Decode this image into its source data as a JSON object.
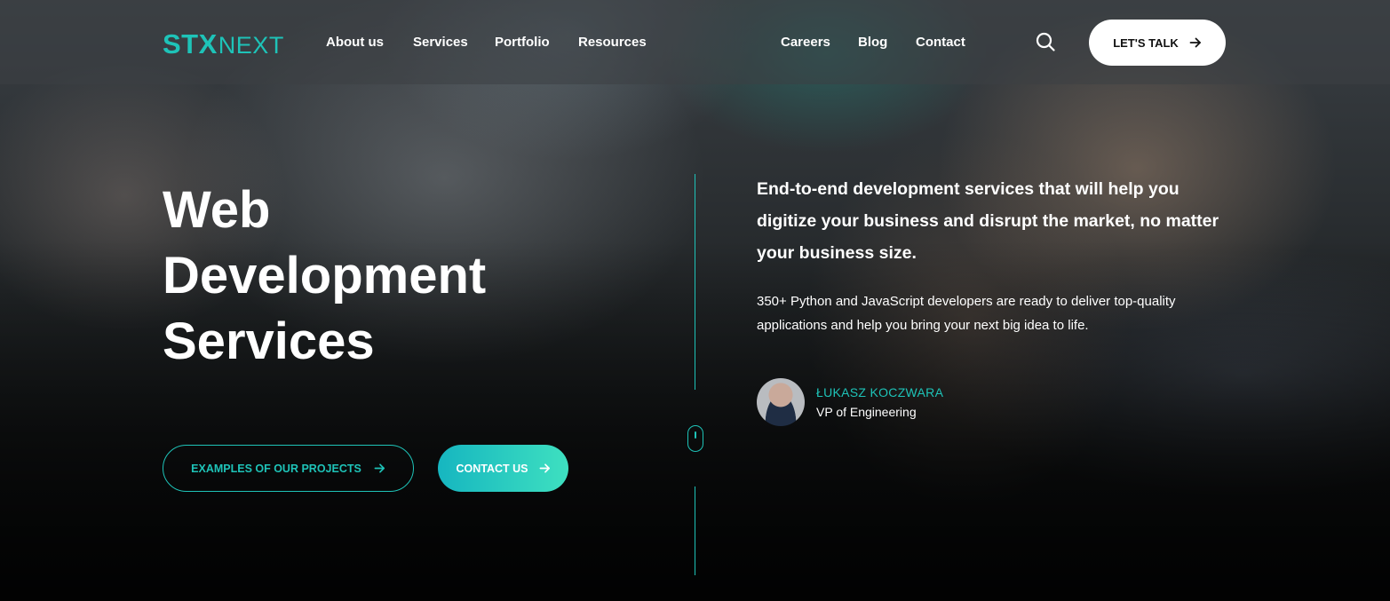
{
  "logo": {
    "stx": "STX",
    "next": "NEXT"
  },
  "nav": {
    "left": [
      "About us",
      "Services",
      "Portfolio",
      "Resources"
    ],
    "right": [
      "Careers",
      "Blog",
      "Contact"
    ]
  },
  "header": {
    "cta_label": "LET'S TALK"
  },
  "hero": {
    "title_lines": [
      "Web",
      "Development",
      "Services"
    ],
    "buttons": {
      "projects_label": "EXAMPLES OF OUR PROJECTS",
      "contact_label": "CONTACT US"
    },
    "lead": "End-to-end development services that will help you digitize your business and disrupt the market, no matter your business size.",
    "sub": "350+ Python and JavaScript developers are ready to deliver top-quality applications and help you bring your next big idea to life.",
    "author": {
      "name": "ŁUKASZ KOCZWARA",
      "role": "VP of Engineering"
    }
  },
  "colors": {
    "accent": "#1ec3b8",
    "gradient_end": "#3ee0c0",
    "cta_bg": "#ffffff"
  },
  "icons": {
    "search": "search-icon",
    "arrow": "arrow-right-icon",
    "scroll": "mouse-scroll-icon"
  }
}
